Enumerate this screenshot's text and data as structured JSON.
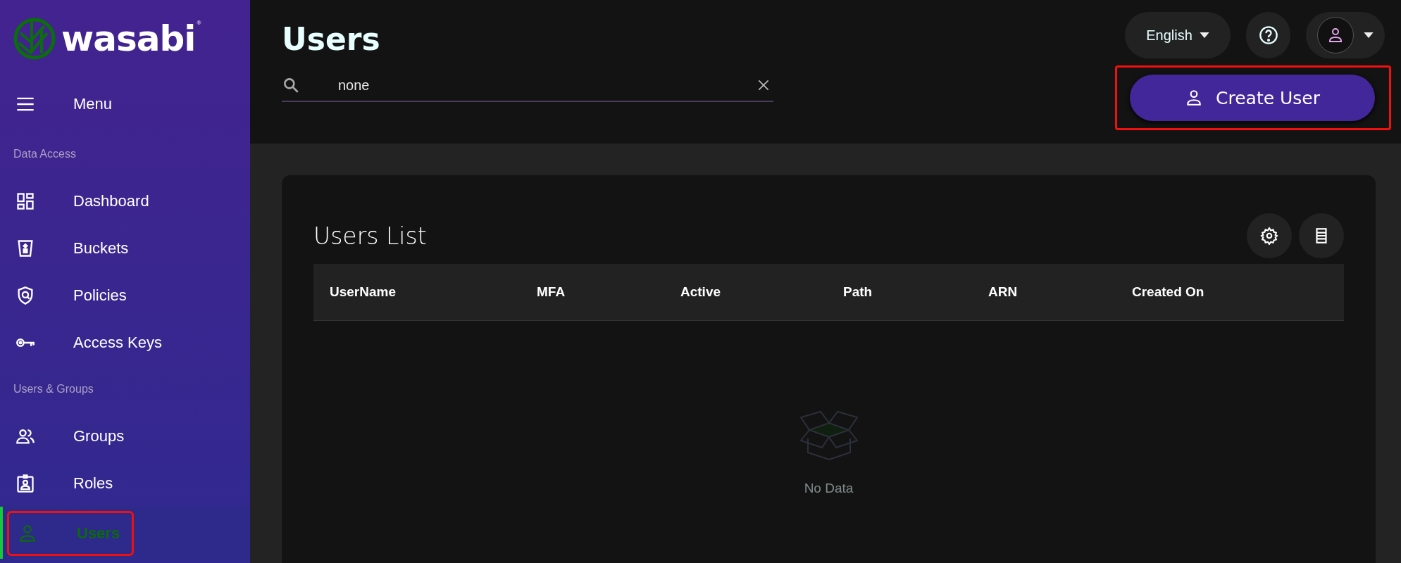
{
  "logo": {
    "text": "wasabi",
    "mark": "®"
  },
  "sidebar": {
    "menu_label": "Menu",
    "sections": [
      {
        "title": "Data Access",
        "items": [
          {
            "label": "Dashboard",
            "kind": "dashboard",
            "selected": false,
            "highlighted": false
          },
          {
            "label": "Buckets",
            "kind": "bucket",
            "selected": false,
            "highlighted": false
          },
          {
            "label": "Policies",
            "kind": "shield",
            "selected": false,
            "highlighted": false
          },
          {
            "label": "Access Keys",
            "kind": "key",
            "selected": false,
            "highlighted": false
          }
        ]
      },
      {
        "title": "Users & Groups",
        "items": [
          {
            "label": "Groups",
            "kind": "group",
            "selected": false,
            "highlighted": false
          },
          {
            "label": "Roles",
            "kind": "badge",
            "selected": false,
            "highlighted": false
          },
          {
            "label": "Users",
            "kind": "user",
            "selected": true,
            "highlighted": true
          }
        ]
      }
    ]
  },
  "header": {
    "title": "Users",
    "search": {
      "value": "none"
    },
    "language": "English",
    "create_button": {
      "label": "Create User",
      "highlighted": true
    }
  },
  "card": {
    "title": "Users List",
    "columns": [
      "UserName",
      "MFA",
      "Active",
      "Path",
      "ARN",
      "Created On"
    ],
    "empty_text": "No Data"
  }
}
